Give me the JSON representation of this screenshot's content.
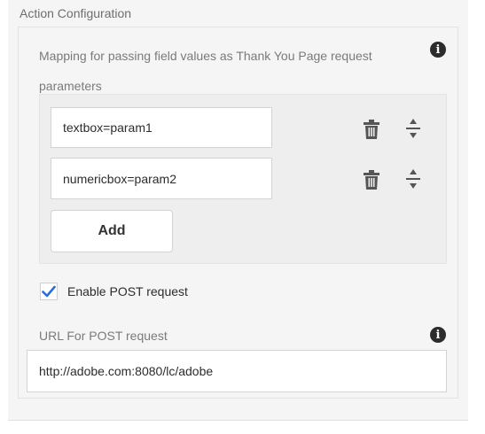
{
  "section": {
    "title": "Action Configuration"
  },
  "mapping": {
    "label": "Mapping for passing field values as Thank You Page request parameters",
    "rows": [
      {
        "value": "textbox=param1",
        "delete_icon": "trash-icon",
        "move_icon": "reorder-icon"
      },
      {
        "value": "numericbox=param2",
        "delete_icon": "trash-icon",
        "move_icon": "reorder-icon"
      }
    ],
    "add_label": "Add",
    "info_icon": "info-icon"
  },
  "post": {
    "checkbox_label": "Enable POST request",
    "checked": true,
    "url_label": "URL For POST request",
    "url_value": "http://adobe.com:8080/lc/adobe",
    "info_icon": "info-icon"
  },
  "colors": {
    "checkmark": "#2c6fd3",
    "panel_bg": "#f5f5f5",
    "icon_dark": "#2c2c2c"
  }
}
